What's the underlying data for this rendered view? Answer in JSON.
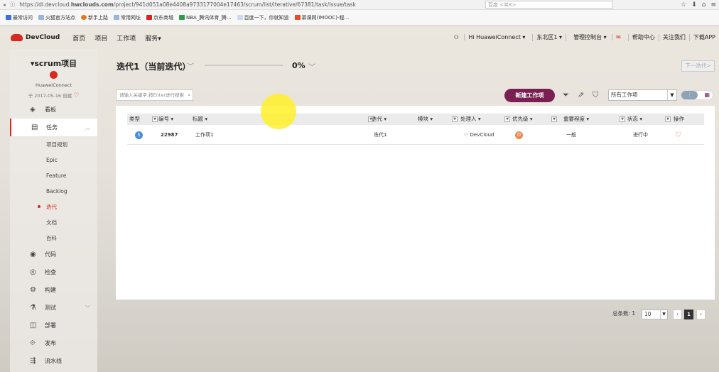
{
  "browser": {
    "url_prefix": "https://dl.devcloud.",
    "url_host": "hwclouds.com",
    "url_path": "/project/941d051a08e4408a9733177004e17463/scrum/list/iterative/67381/task/issue/task",
    "search_placeholder": "百度 <⌘K>",
    "bookmarks": [
      "最常访问",
      "火狐官方站点",
      "新手上路",
      "常用网址",
      "京东商城",
      "NBA_腾讯体育_腾...",
      "百度一下，你就知道",
      "慕课网(IMOOC)-程..."
    ]
  },
  "topnav": {
    "logo": "DevCloud",
    "links": [
      "首页",
      "项目",
      "工作项",
      "服务▾"
    ],
    "right": [
      "Hi HuaweiConnect ▾",
      "东北区1 ▾",
      "管理控制台 ▾",
      "帮助中心",
      "关注我们",
      "下载APP"
    ]
  },
  "project": {
    "name": "▾scrum项目",
    "owner": "HuaweiConnect",
    "created": "于 2017-05-16 创建"
  },
  "sidebar": {
    "items": [
      {
        "label": "看板",
        "icon": "layers-icon"
      },
      {
        "label": "任务",
        "icon": "task-list-icon",
        "expanded": true
      },
      {
        "label": "代码",
        "icon": "camera-icon"
      },
      {
        "label": "检查",
        "icon": "scan-icon"
      },
      {
        "label": "构建",
        "icon": "gear-icon"
      },
      {
        "label": "测试",
        "icon": "flask-icon"
      },
      {
        "label": "部署",
        "icon": "box-icon"
      },
      {
        "label": "发布",
        "icon": "publish-icon"
      },
      {
        "label": "流水线",
        "icon": "pipeline-icon"
      }
    ],
    "sub_items": [
      "项目规划",
      "Epic",
      "Feature",
      "Backlog",
      "迭代",
      "文档",
      "百科"
    ]
  },
  "iteration": {
    "title": "迭代1（当前迭代）",
    "progress_text": "0%",
    "progress": 0,
    "next_button": "下一迭代>"
  },
  "toolbar": {
    "search_placeholder": "请输入关键字,按Enter进行搜索",
    "new_button": "新建工作项",
    "filter_value": "所有工作项"
  },
  "table": {
    "headers": [
      "类型",
      "编号",
      "标题",
      "迭代",
      "模块",
      "处理人",
      "优先级",
      "重要程度",
      "状态",
      "操作"
    ],
    "rows": [
      {
        "type": "S",
        "id": "22987",
        "title": "工作项1",
        "iteration": "迭代1",
        "module": "",
        "assignee": "DevCloud",
        "priority": "中",
        "importance": "一般",
        "status": "进行中"
      }
    ]
  },
  "pager": {
    "total": "总条数: 1",
    "page_size": "10",
    "current_page": "1"
  },
  "colors": {
    "accent": "#d9281e",
    "primary_button": "#7a1f52"
  }
}
